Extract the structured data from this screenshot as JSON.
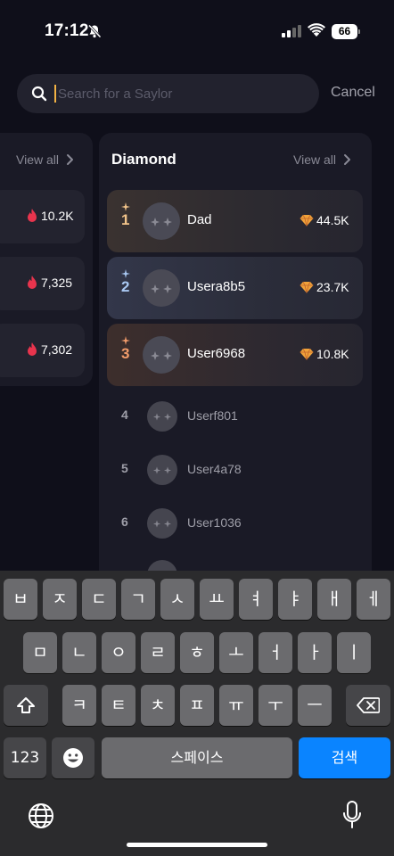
{
  "status_bar": {
    "time": "17:12",
    "battery": "66"
  },
  "search": {
    "placeholder": "Search for a Saylor",
    "value": "",
    "cancel_label": "Cancel"
  },
  "left_card": {
    "view_all_label": "View all",
    "rows": [
      {
        "value": "10.2K"
      },
      {
        "value": "7,325"
      },
      {
        "value": "7,302"
      }
    ]
  },
  "diamond_card": {
    "title": "Diamond",
    "view_all_label": "View all",
    "top_rows": [
      {
        "rank": "1",
        "name": "Dad",
        "score": "44.5K",
        "rank_color": "#f2c48a"
      },
      {
        "rank": "2",
        "name": "Usera8b5",
        "score": "23.7K",
        "rank_color": "#a9c8f2"
      },
      {
        "rank": "3",
        "name": "User6968",
        "score": "10.8K",
        "rank_color": "#f29c6b"
      }
    ],
    "other_rows": [
      {
        "rank": "4",
        "name": "Userf801"
      },
      {
        "rank": "5",
        "name": "User4a78"
      },
      {
        "rank": "6",
        "name": "User1036"
      }
    ]
  },
  "keyboard": {
    "row1": [
      "ㅂ",
      "ㅈ",
      "ㄷ",
      "ㄱ",
      "ㅅ",
      "ㅛ",
      "ㅕ",
      "ㅑ",
      "ㅐ",
      "ㅔ"
    ],
    "row2": [
      "ㅁ",
      "ㄴ",
      "ㅇ",
      "ㄹ",
      "ㅎ",
      "ㅗ",
      "ㅓ",
      "ㅏ",
      "ㅣ"
    ],
    "row3": [
      "ㅋ",
      "ㅌ",
      "ㅊ",
      "ㅍ",
      "ㅠ",
      "ㅜ",
      "ㅡ"
    ],
    "numbers_label": "123",
    "space_label": "스페이스",
    "search_label": "검색"
  },
  "colors": {
    "accent": "#0a84ff",
    "caret": "#f2b244",
    "fire": "#e8344d",
    "background": "#0f0f1a"
  }
}
